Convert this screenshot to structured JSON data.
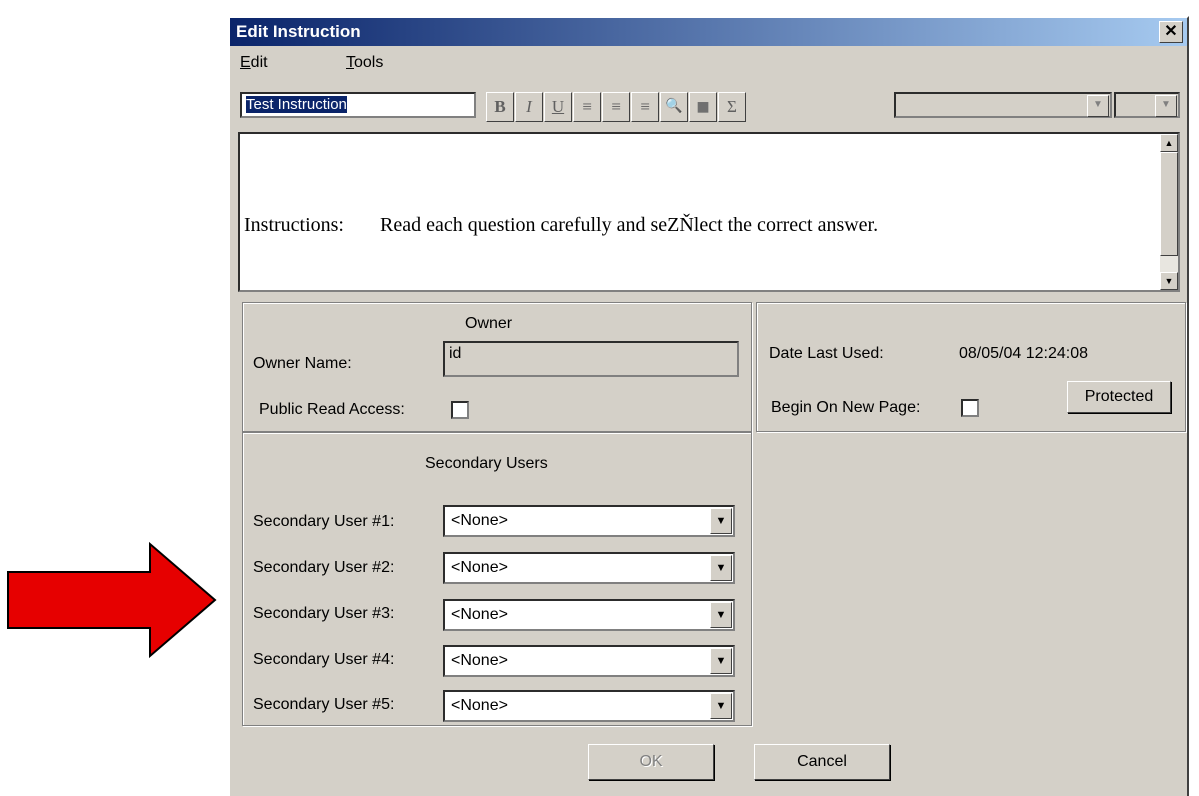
{
  "window": {
    "title": "Edit Instruction",
    "close_symbol": "✕"
  },
  "menu": [
    {
      "label": "Edit",
      "accel": "E",
      "rest": "dit"
    },
    {
      "label": "Tools",
      "accel": "T",
      "rest": "ools"
    }
  ],
  "toolbar": {
    "name_value": "Test Instruction",
    "buttons": [
      {
        "icon": "bold-icon",
        "glyph": "B"
      },
      {
        "icon": "italic-icon",
        "glyph": "I"
      },
      {
        "icon": "underline-icon",
        "glyph": "U"
      },
      {
        "icon": "align-left-icon",
        "glyph": "≡"
      },
      {
        "icon": "align-center-icon",
        "glyph": "≡"
      },
      {
        "icon": "align-right-icon",
        "glyph": "≡"
      },
      {
        "icon": "magnify-icon",
        "glyph": "🔍"
      },
      {
        "icon": "color-box-icon",
        "glyph": "■"
      },
      {
        "icon": "sigma-icon",
        "glyph": "Σ"
      }
    ]
  },
  "editor": {
    "label": "Instructions:",
    "text": "Read each question carefully and seZŇlect the correct answer."
  },
  "owner": {
    "heading": "Owner",
    "name_label": "Owner Name:",
    "name_value": "id",
    "public_label": "Public Read Access:"
  },
  "info": {
    "date_label": "Date Last Used:",
    "date_value": "08/05/04 12:24:08",
    "new_page_label": "Begin On New Page:",
    "protected_label": "Protected"
  },
  "secondary": {
    "heading": "Secondary Users",
    "users": [
      {
        "label": "Secondary User #1:",
        "value": "<None>"
      },
      {
        "label": "Secondary User #2:",
        "value": "<None>"
      },
      {
        "label": "Secondary User #3:",
        "value": "<None>"
      },
      {
        "label": "Secondary User #4:",
        "value": "<None>"
      },
      {
        "label": "Secondary User #5:",
        "value": "<None>"
      }
    ]
  },
  "buttons": {
    "ok": "OK",
    "cancel": "Cancel"
  },
  "colors": {
    "arrow": "#e60000",
    "title_start": "#0a246a",
    "title_end": "#a6caf0",
    "face": "#d4d0c8"
  }
}
